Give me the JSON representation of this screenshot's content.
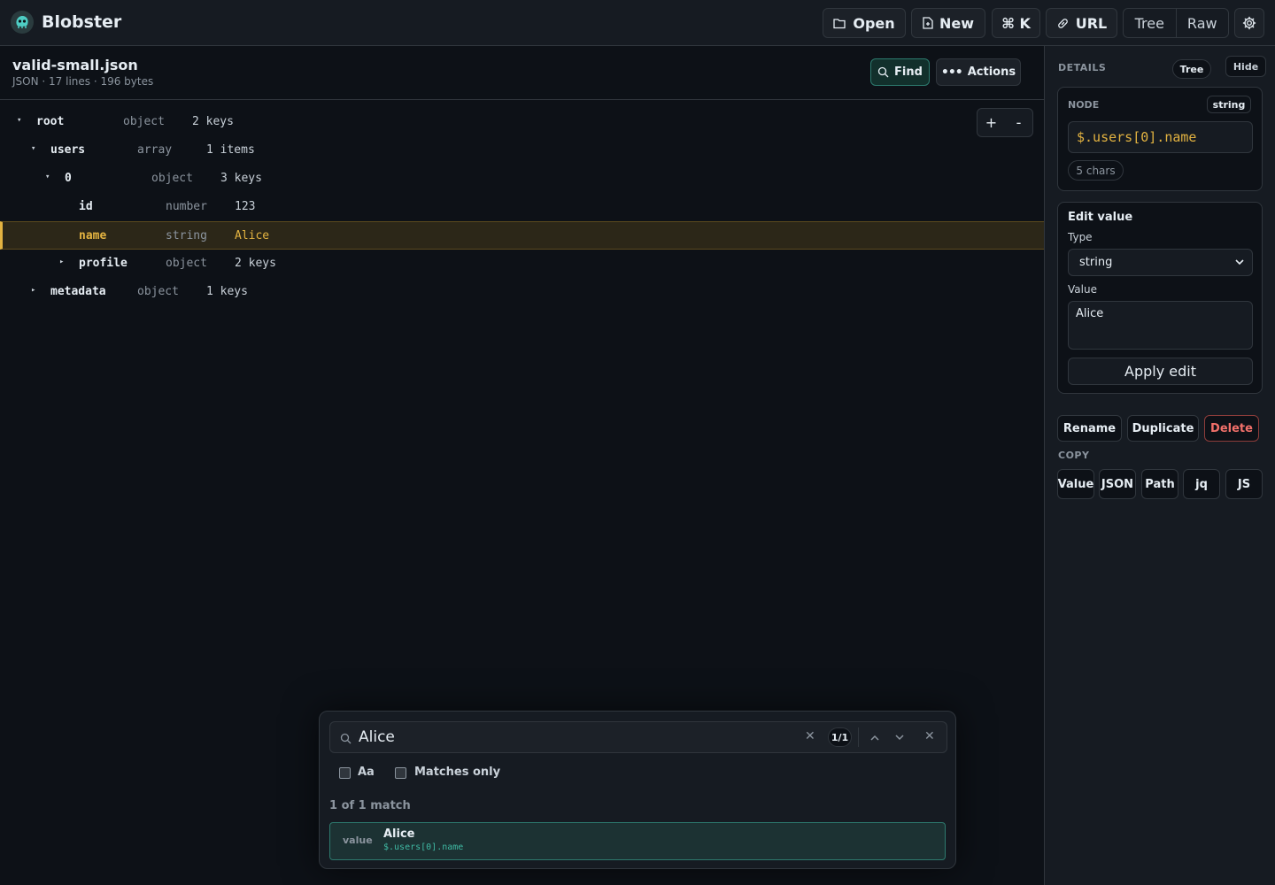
{
  "app": {
    "name": "Blobster",
    "toolbar": {
      "open": "Open",
      "new": "New",
      "command": "⌘ K",
      "url": "URL",
      "view_tree": "Tree",
      "view_raw": "Raw"
    }
  },
  "file": {
    "name": "valid-small.json",
    "meta": "JSON · 17 lines · 196 bytes",
    "find_label": "Find",
    "actions_label": "Actions"
  },
  "tree": {
    "expand_all": "+",
    "collapse_all": "-",
    "rows": [
      {
        "caret": "▾",
        "key": "root",
        "type": "object",
        "value": "2 keys"
      },
      {
        "caret": "▾",
        "key": "users",
        "type": "array",
        "value": "1 items"
      },
      {
        "caret": "▾",
        "key": "0",
        "type": "object",
        "value": "3 keys"
      },
      {
        "caret": "",
        "key": "id",
        "type": "number",
        "value": "123"
      },
      {
        "caret": "",
        "key": "name",
        "type": "string",
        "value": "Alice"
      },
      {
        "caret": "▸",
        "key": "profile",
        "type": "object",
        "value": "2 keys"
      },
      {
        "caret": "▸",
        "key": "metadata",
        "type": "object",
        "value": "1 keys"
      }
    ]
  },
  "details": {
    "title": "DETAILS",
    "view_tree": "Tree",
    "hide": "Hide",
    "node_label": "NODE",
    "node_type": "string",
    "path": "$.users[0].name",
    "chars": "5 chars",
    "edit_title": "Edit value",
    "type_label": "Type",
    "type_value": "string",
    "value_label": "Value",
    "value": "Alice",
    "apply": "Apply edit",
    "rename": "Rename",
    "duplicate": "Duplicate",
    "delete": "Delete",
    "copy_title": "COPY",
    "copy": {
      "value": "Value",
      "json": "JSON",
      "path": "Path",
      "jq": "jq",
      "js": "JS"
    }
  },
  "find": {
    "query": "Alice",
    "count": "1/1",
    "case_label": "Aa",
    "matches_only_label": "Matches only",
    "summary": "1 of 1 match",
    "result": {
      "kind": "value",
      "text": "Alice",
      "path": "$.users[0].name"
    }
  },
  "colors": {
    "background": "#0d1117",
    "panel": "#161b22",
    "border": "#30363d",
    "accent_highlight": "#e3b341",
    "accent_teal": "#3fb9a3",
    "danger": "#f0706a"
  }
}
